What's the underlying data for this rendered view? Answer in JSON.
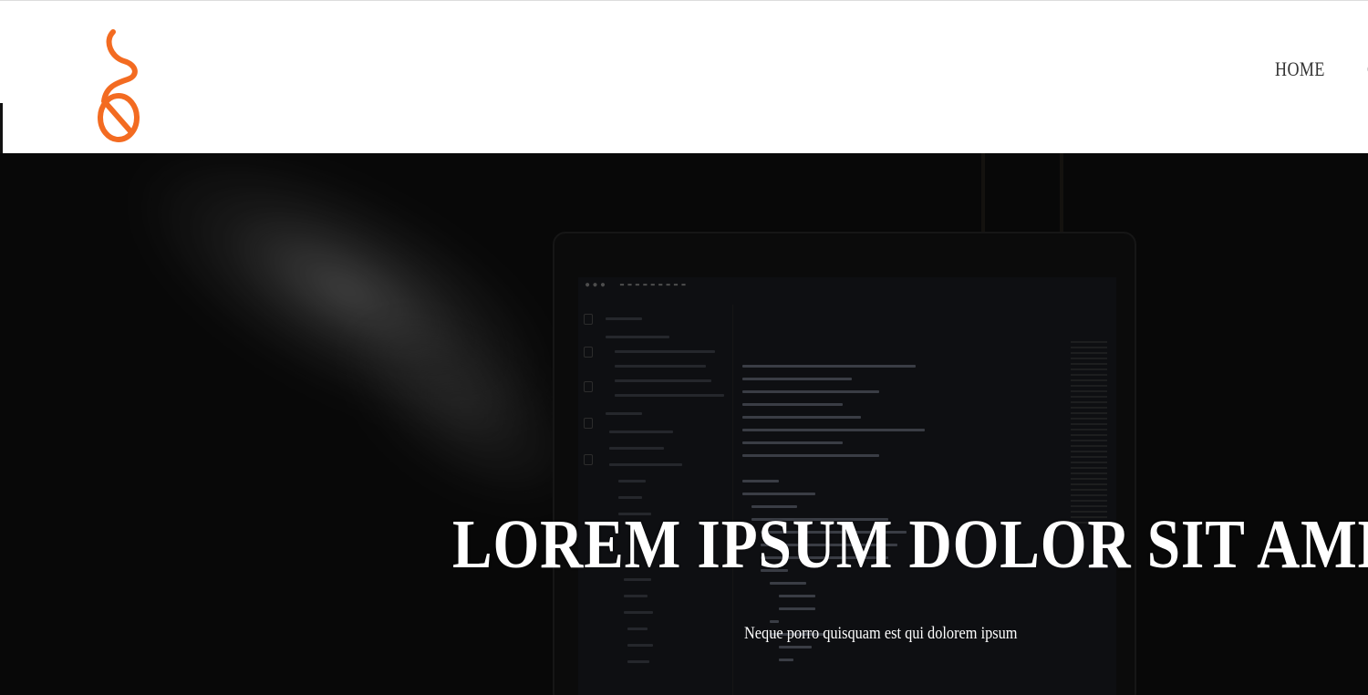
{
  "nav": {
    "items": [
      {
        "label": "HOME"
      },
      {
        "label": "CO"
      }
    ]
  },
  "hero": {
    "title": "LOREM IPSUM DOLOR SIT AMET",
    "subtitle": "Neque porro quisquam est qui dolorem ipsum"
  },
  "colors": {
    "accent": "#f36b21",
    "hero_bg": "#0d0d0d",
    "header_bg": "#ffffff"
  },
  "icons": {
    "logo": "orange-script-logo"
  }
}
